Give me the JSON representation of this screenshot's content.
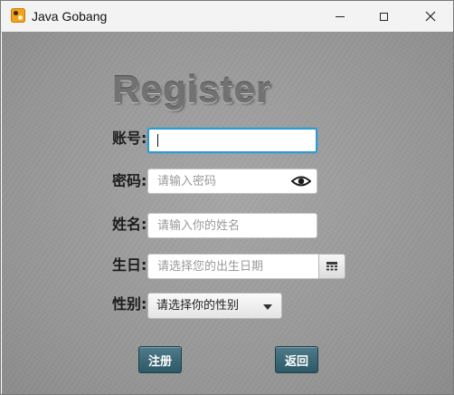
{
  "window": {
    "title": "Java Gobang",
    "app_icon": "gobang-icon",
    "controls": [
      "minimize-icon",
      "maximize-icon",
      "close-icon"
    ]
  },
  "form": {
    "heading": "Register",
    "account": {
      "label": "账号:",
      "value": "",
      "placeholder": ""
    },
    "password": {
      "label": "密码:",
      "value": "",
      "placeholder": "请输入密码",
      "toggle_icon": "eye-icon"
    },
    "name": {
      "label": "姓名:",
      "value": "",
      "placeholder": "请输入你的姓名"
    },
    "birthday": {
      "label": "生日:",
      "value": "",
      "placeholder": "请选择您的出生日期",
      "picker_icon": "calendar-icon"
    },
    "gender": {
      "label": "性别:",
      "selected": "请选择你的性别"
    }
  },
  "buttons": {
    "register": "注册",
    "back": "返回"
  },
  "colors": {
    "focus_border": "#2f9bd4",
    "button_bg": "#3c6775",
    "background": "#9c9c9c",
    "title_bar": "#f3f3f3"
  }
}
